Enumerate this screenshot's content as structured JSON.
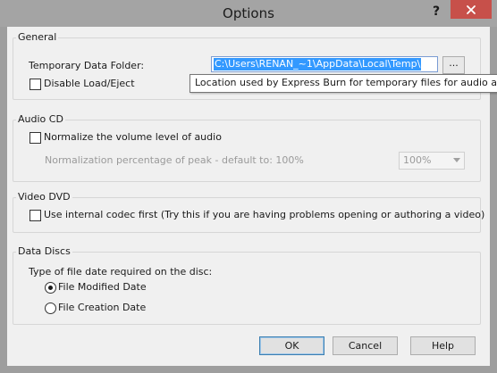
{
  "window": {
    "title": "Options",
    "help_glyph": "?"
  },
  "general": {
    "label": "General",
    "temp_folder_label": "Temporary Data Folder:",
    "temp_folder_value": "C:\\Users\\RENAN_~1\\AppData\\Local\\Temp\\",
    "browse_label": "...",
    "disable_load_eject_label": "Disable Load/Eject",
    "disable_load_eject_checked": false,
    "tooltip": "Location used by Express Burn for temporary files for audio and"
  },
  "audio_cd": {
    "label": "Audio CD",
    "normalize_label": "Normalize the volume level of audio",
    "normalize_checked": false,
    "percentage_label": "Normalization percentage of peak - default to: 100%",
    "percentage_value": "100%"
  },
  "video_dvd": {
    "label": "Video DVD",
    "codec_label": "Use internal codec first (Try this if you are having problems opening or authoring a video)",
    "codec_checked": false
  },
  "data_discs": {
    "label": "Data Discs",
    "prompt": "Type of file date required on the disc:",
    "options": [
      "File Modified Date",
      "File Creation Date"
    ],
    "selected_index": 0
  },
  "buttons": {
    "ok": "OK",
    "cancel": "Cancel",
    "help": "Help"
  },
  "colors": {
    "close_button": "#c7504a",
    "selection": "#3399ff",
    "dialog_background": "#f0f0f0"
  }
}
